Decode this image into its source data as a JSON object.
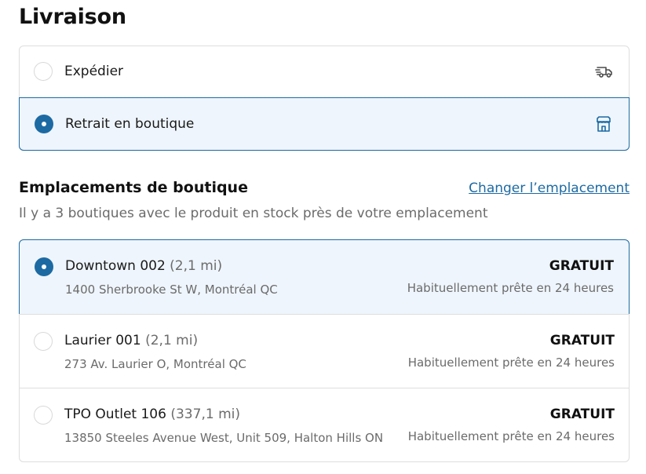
{
  "page": {
    "title": "Livraison"
  },
  "delivery_methods": [
    {
      "label": "Expédier",
      "selected": false,
      "icon": "truck-icon"
    },
    {
      "label": "Retrait en boutique",
      "selected": true,
      "icon": "store-icon"
    }
  ],
  "stores_section": {
    "title": "Emplacements de boutique",
    "change_link": "Changer l’emplacement",
    "subtitle": "Il y a 3 boutiques avec le produit en stock près de votre emplacement"
  },
  "stores": [
    {
      "name": "Downtown 002",
      "distance": "(2,1 mi)",
      "address": "1400 Sherbrooke St W, Montréal QC",
      "price": "GRATUIT",
      "ready": "Habituellement prête en 24 heures",
      "selected": true
    },
    {
      "name": "Laurier 001",
      "distance": "(2,1 mi)",
      "address": "273 Av. Laurier O, Montréal QC",
      "price": "GRATUIT",
      "ready": "Habituellement prête en 24 heures",
      "selected": false
    },
    {
      "name": "TPO Outlet 106",
      "distance": "(337,1 mi)",
      "address": "13850 Steeles Avenue West, Unit 509, Halton Hills ON",
      "price": "GRATUIT",
      "ready": "Habituellement prête en 24 heures",
      "selected": false
    }
  ],
  "colors": {
    "accent": "#1d6aa3",
    "selected_bg": "#eef5fc",
    "border": "#dedede",
    "muted_text": "#6b6b6b"
  }
}
